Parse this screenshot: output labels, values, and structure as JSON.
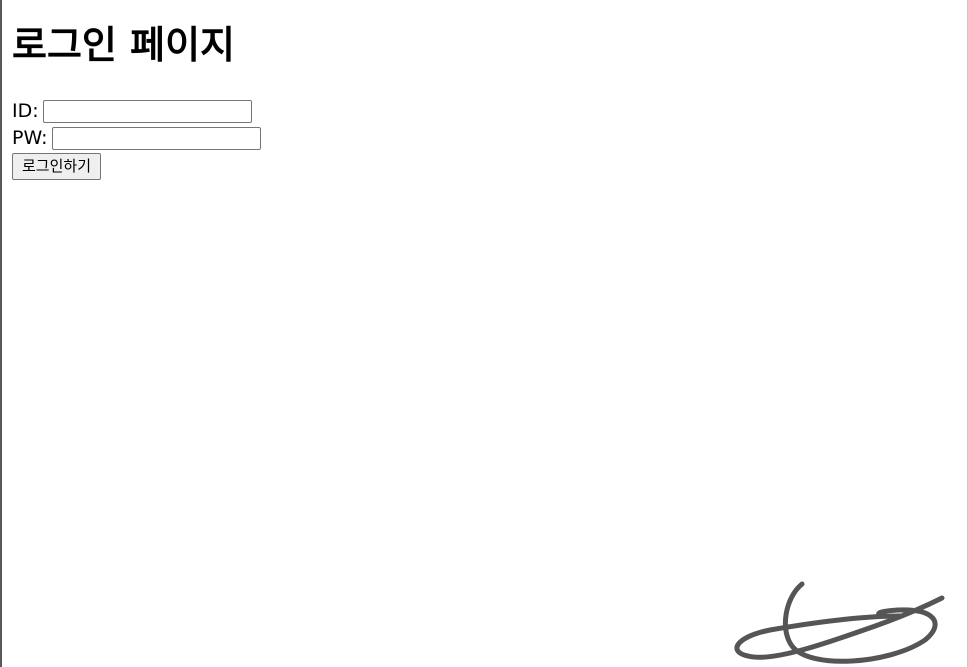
{
  "page": {
    "title": "로그인 페이지"
  },
  "login_form": {
    "id_label": "ID:",
    "id_value": "",
    "pw_label": "PW:",
    "pw_value": "",
    "submit_label": "로그인하기"
  },
  "colors": {
    "text": "#000000",
    "button_bg": "#efefef",
    "input_border": "#767676",
    "signature_stroke": "#555555"
  }
}
